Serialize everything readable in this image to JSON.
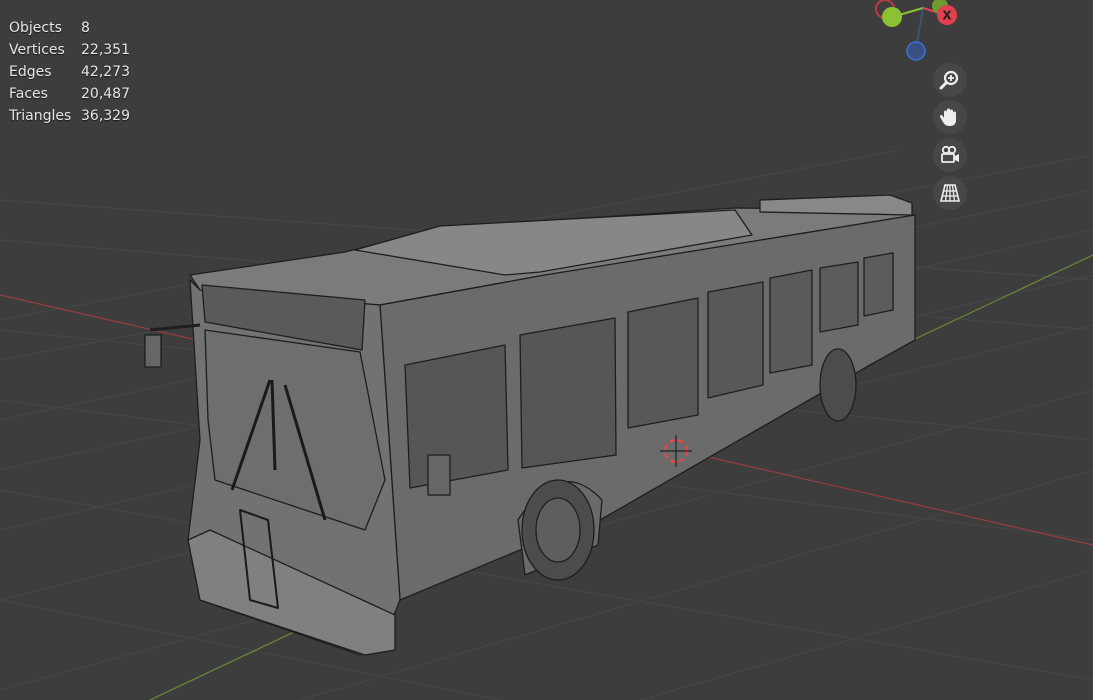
{
  "statistics": [
    {
      "label": "Objects",
      "value": "8"
    },
    {
      "label": "Vertices",
      "value": "22,351"
    },
    {
      "label": "Edges",
      "value": "42,273"
    },
    {
      "label": "Faces",
      "value": "20,487"
    },
    {
      "label": "Triangles",
      "value": "36,329"
    }
  ],
  "gizmo": {
    "x_label": "X",
    "x_color": "#e0404f",
    "y_color": "#8bc234",
    "z_color": "#3f6fd6"
  },
  "navigation": [
    {
      "name": "zoom-view-icon"
    },
    {
      "name": "pan-view-icon"
    },
    {
      "name": "camera-view-icon"
    },
    {
      "name": "perspective-toggle-icon"
    }
  ],
  "colors": {
    "background": "#3d3d3d",
    "grid": "#474747",
    "x_axis": "#9a3c42",
    "y_axis": "#6d8a36",
    "model_fill": "#6f6f6f",
    "wire": "#1e1e1e"
  }
}
